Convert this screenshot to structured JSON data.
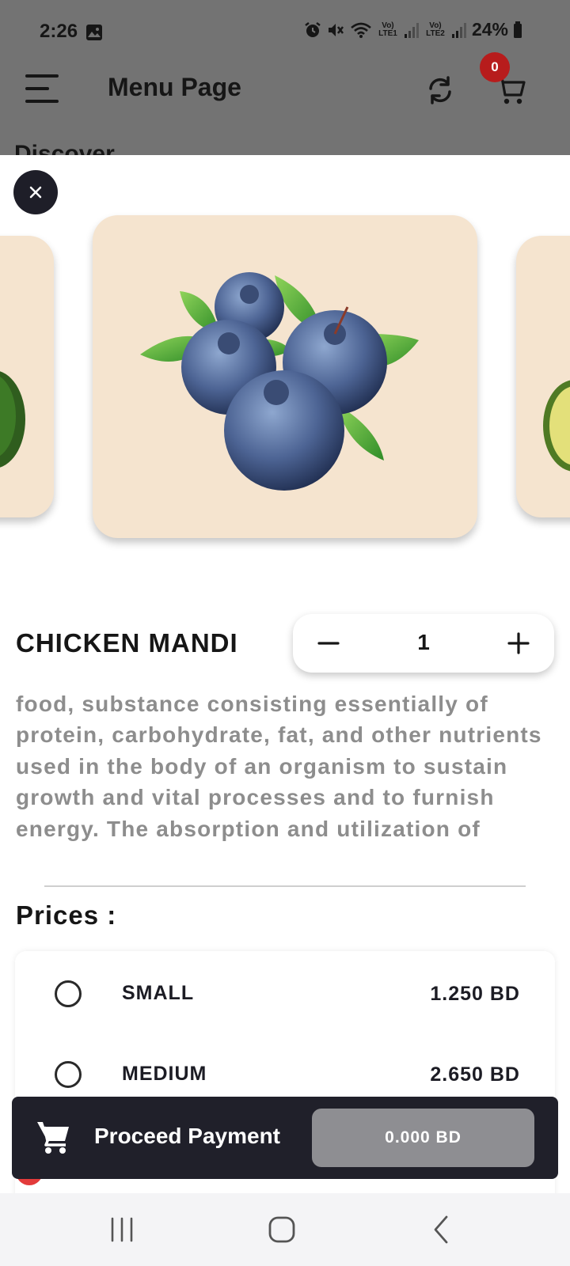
{
  "status_bar": {
    "time": "2:26",
    "network_1": "Vo) LTE1",
    "network_2": "Vo) LTE2",
    "battery": "24%"
  },
  "app_bar": {
    "title": "Menu Page",
    "cart_count": "0",
    "background_heading": "Discover"
  },
  "product": {
    "name": "CHICKEN MANDI",
    "quantity": "1",
    "description": "food, substance consisting essentially of protein, carbohydrate, fat, and other nutrients used in the body of an organism to sustain growth and vital processes and to furnish energy. The absorption and utilization of",
    "image_subject": "blueberries",
    "card_color": "#f5e4cf"
  },
  "prices": {
    "label": "Prices :",
    "options": [
      {
        "size": "SMALL",
        "price": "1.250 BD",
        "selected": false
      },
      {
        "size": "MEDIUM",
        "price": "2.650 BD",
        "selected": false
      }
    ]
  },
  "payment": {
    "label": "Proceed Payment",
    "total": "0.000 BD"
  },
  "icons": {
    "menu": "hamburger-icon",
    "refresh": "refresh-icon",
    "cart": "cart-icon",
    "close": "close-icon",
    "minus": "minus-icon",
    "plus": "plus-icon",
    "recents": "recents-icon",
    "home": "home-icon",
    "back": "back-icon"
  },
  "colors": {
    "dark": "#20202a",
    "badge": "#b71c1c",
    "overlay": "#737373",
    "total_button": "#8e8e92"
  }
}
